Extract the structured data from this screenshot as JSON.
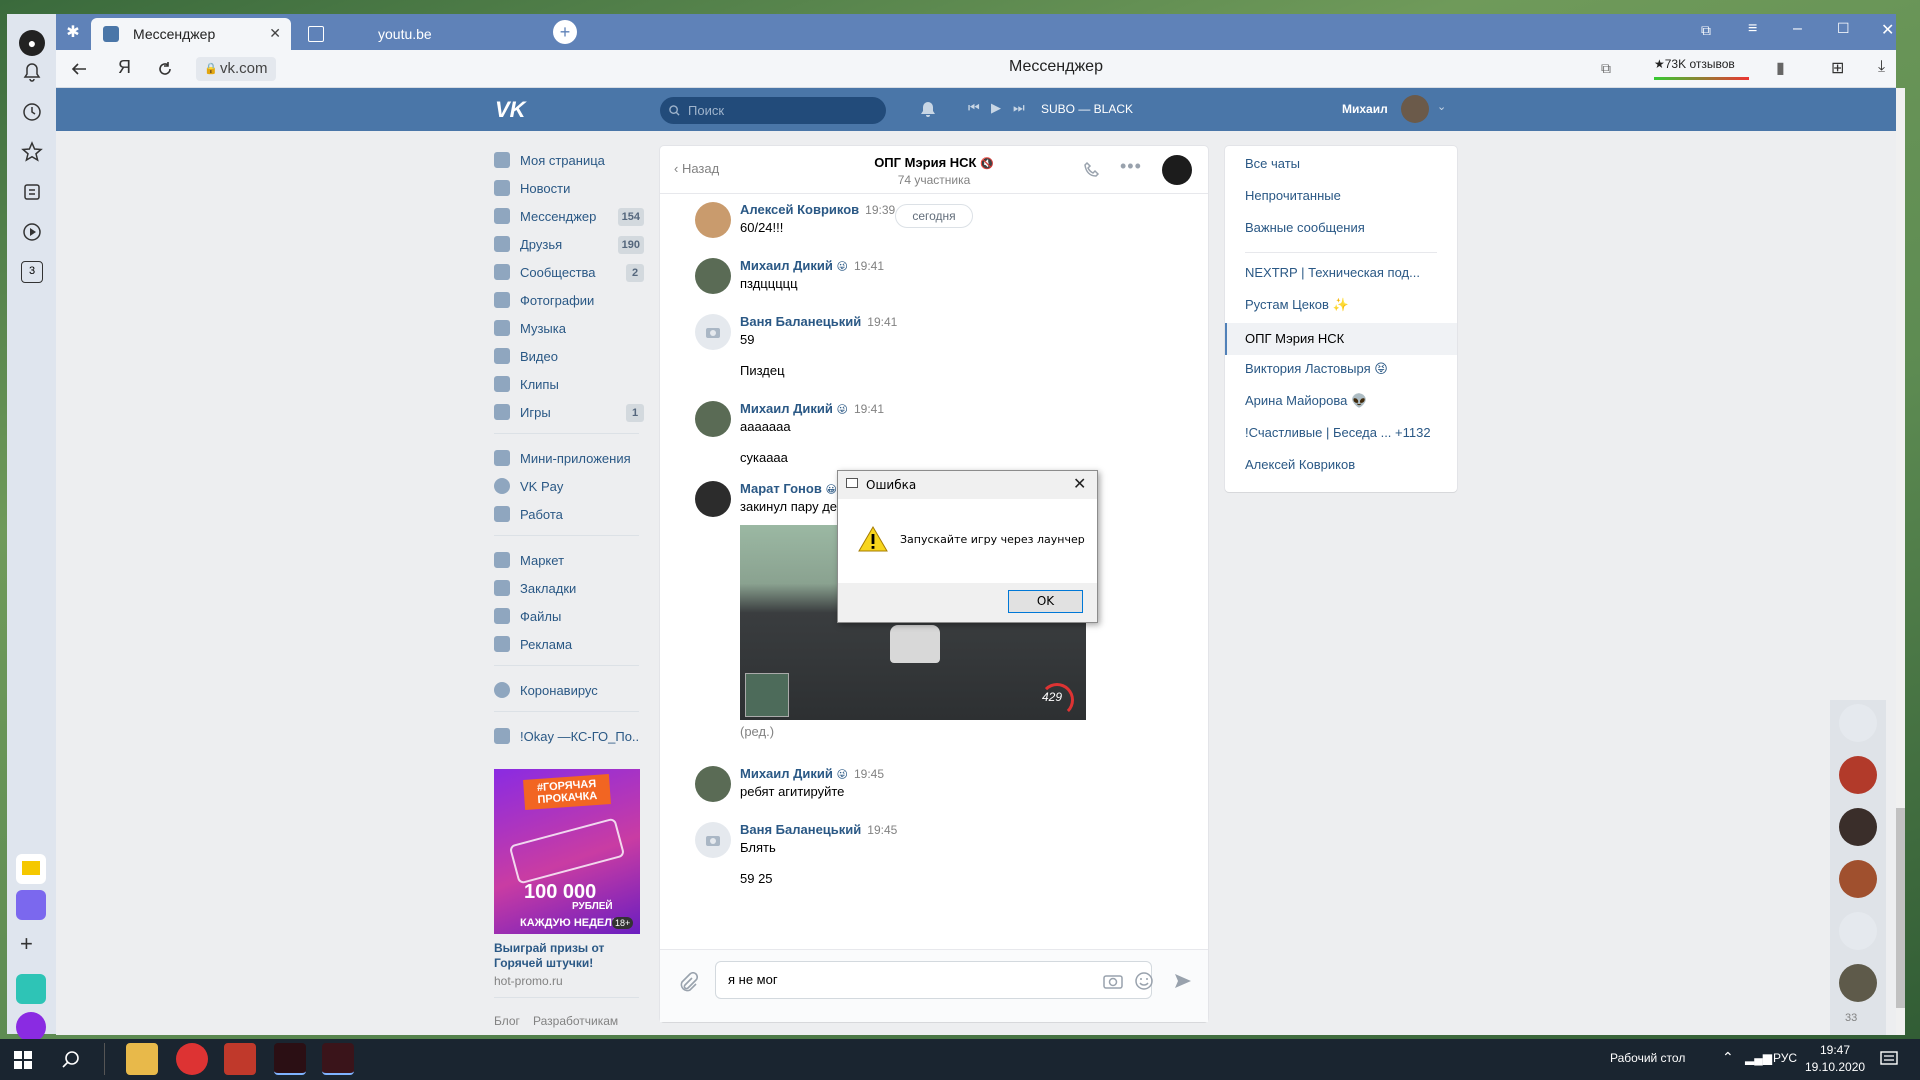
{
  "browser": {
    "tabs": [
      {
        "label": "Мессенджер",
        "active": true
      },
      {
        "label": "youtu.be",
        "active": false
      }
    ],
    "page_title": "Мессенджер",
    "url": "vk.com",
    "reviews_label": "★73K отзывов",
    "left_panel_badge": "3"
  },
  "vk": {
    "search_placeholder": "Поиск",
    "player_track": "SUBO — BLACK",
    "user_name": "Михаил",
    "nav": [
      {
        "label": "Моя страница",
        "badge": ""
      },
      {
        "label": "Новости",
        "badge": ""
      },
      {
        "label": "Мессенджер",
        "badge": "154"
      },
      {
        "label": "Друзья",
        "badge": "190"
      },
      {
        "label": "Сообщества",
        "badge": "2"
      },
      {
        "label": "Фотографии",
        "badge": ""
      },
      {
        "label": "Музыка",
        "badge": ""
      },
      {
        "label": "Видео",
        "badge": ""
      },
      {
        "label": "Клипы",
        "badge": ""
      },
      {
        "label": "Игры",
        "badge": "1"
      }
    ],
    "nav2": [
      "Мини-приложения",
      "VK Pay",
      "Работа"
    ],
    "nav3": [
      "Маркет",
      "Закладки",
      "Файлы",
      "Реклама"
    ],
    "nav4": [
      "Коронавирус"
    ],
    "nav5": [
      "!Okay —КС-ГО_По.."
    ],
    "ad": {
      "banner_top": "#ГОРЯЧАЯ ПРОКАЧКА",
      "banner_amount": "100 000",
      "banner_currency": "РУБЛЕЙ",
      "banner_bottom": "КАЖДУЮ НЕДЕЛЮ",
      "age": "18+",
      "title": "Выиграй призы от Горячей штучки!",
      "domain": "hot-promo.ru"
    },
    "footer_links": [
      "Блог",
      "Разработчикам"
    ]
  },
  "chat": {
    "back_label": "Назад",
    "title": "ОПГ Мэрия НСК",
    "subtitle": "74 участника",
    "date_pill": "сегодня",
    "messages": [
      {
        "author": "Алексей Ковриков",
        "time": "19:39",
        "lines": [
          "60/24!!!"
        ]
      },
      {
        "author": "Михаил Дикий",
        "emoji": "😜",
        "time": "19:41",
        "lines": [
          "пздццццц"
        ]
      },
      {
        "author": "Ваня Баланецький",
        "time": "19:41",
        "lines": [
          "59",
          "Пиздец"
        ]
      },
      {
        "author": "Михаил Дикий",
        "emoji": "😜",
        "time": "19:41",
        "lines": [
          "ааааааа",
          "сукаааа"
        ]
      },
      {
        "author": "Марат Гонов",
        "emoji": "😀",
        "time": "",
        "lines": [
          "закинул пару де"
        ]
      },
      {
        "author": "Михаил Дикий",
        "emoji": "😜",
        "time": "19:45",
        "lines": [
          "ребят агитируйте"
        ]
      },
      {
        "author": "Ваня Баланецький",
        "time": "19:45",
        "lines": [
          "Блять",
          "59 25"
        ]
      }
    ],
    "screenshot_speed": "429",
    "edited_label": "(ред.)",
    "composer_value": "я не мог"
  },
  "chat_list": {
    "items": [
      {
        "label": "Все чаты"
      },
      {
        "label": "Непрочитанные"
      },
      {
        "label": "Важные сообщения"
      },
      {
        "label": "NEXTRP | Техническая под..."
      },
      {
        "label": "Рустам Цеков ✨"
      },
      {
        "label": "ОПГ Мэрия НСК",
        "active": true
      },
      {
        "label": "Виктория Ластовыря 😝"
      },
      {
        "label": "Арина Майорова 👽"
      },
      {
        "label": "!Счастливые | Беседа ... +1132"
      },
      {
        "label": "Алексей Ковриков"
      }
    ]
  },
  "dialog": {
    "title": "Ошибка",
    "message": "Запускайте игру через лаунчер",
    "ok_label": "OK"
  },
  "float_count": "33",
  "taskbar": {
    "desktop_label": "Рабочий стол",
    "lang": "РУС",
    "time": "19:47",
    "date": "19.10.2020"
  },
  "colors": {
    "vk_header": "#4a76a8",
    "vk_link": "#2a5885",
    "browser_tabbar": "#5f82b8"
  }
}
